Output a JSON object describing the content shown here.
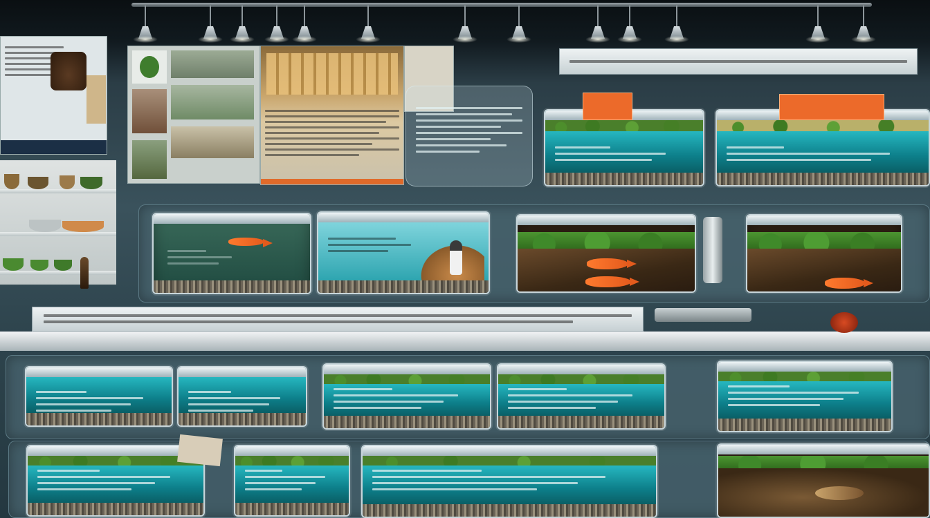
{
  "scene": {
    "description_free": true,
    "palette": {
      "wall": "#3f5862",
      "water": "#26b7c0",
      "soil": "#3a2815",
      "fish": "#ff7a2e",
      "moss": "#4c9531",
      "label_orange": "#ec6a2a"
    },
    "icons": [
      "ceiling-lamp-icon",
      "fish-icon"
    ]
  }
}
